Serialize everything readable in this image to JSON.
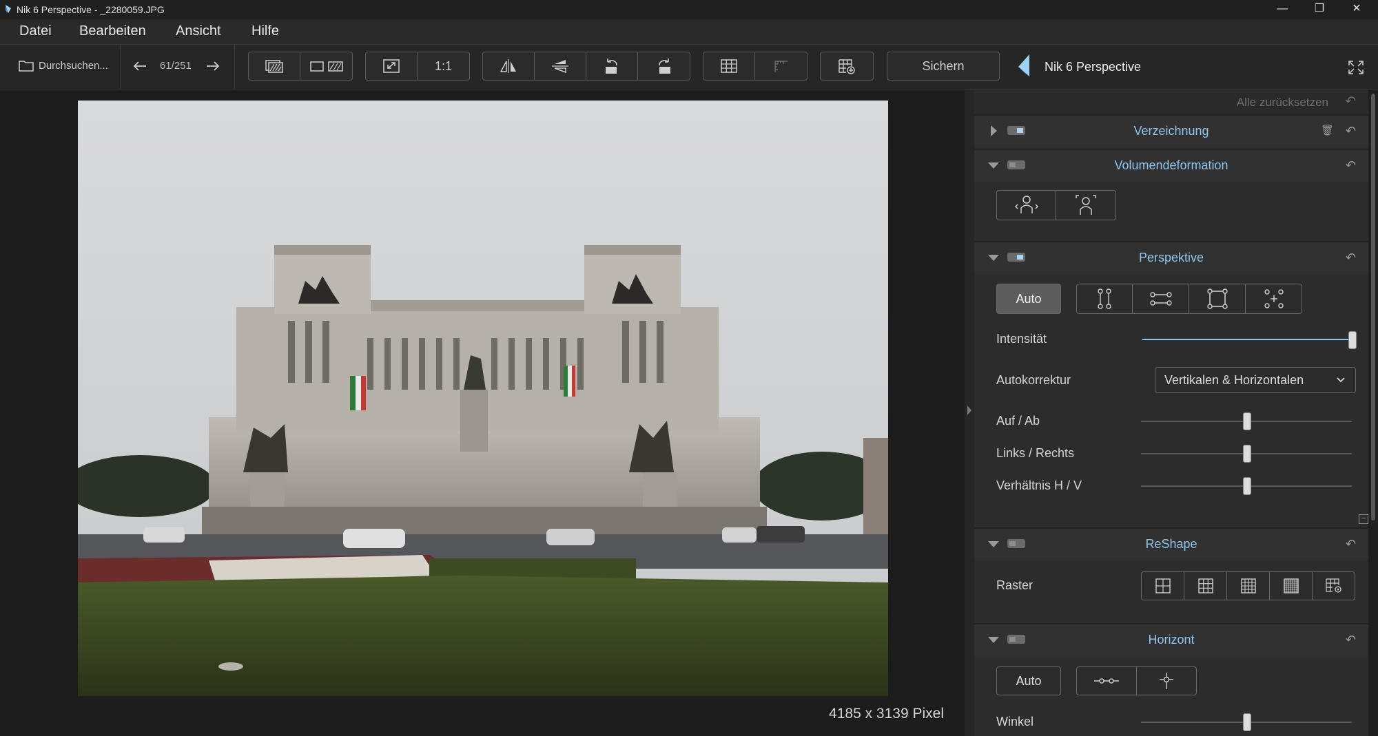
{
  "window": {
    "title": "Nik 6 Perspective - _2280059.JPG",
    "minimize": "—",
    "restore": "❐",
    "close": "✕"
  },
  "menu": [
    "Datei",
    "Bearbeiten",
    "Ansicht",
    "Hilfe"
  ],
  "toolbar": {
    "browse_label": "Durchsuchen...",
    "counter": "61/251",
    "zoom_1to1": "1:1",
    "save_label": "Sichern",
    "app_name": "Nik 6 Perspective"
  },
  "canvas": {
    "dimensions": "4185 x 3139 Pixel"
  },
  "panel": {
    "reset_all": "Alle zurücksetzen",
    "sections": {
      "verzeichnung": {
        "title": "Verzeichnung"
      },
      "volumendeformation": {
        "title": "Volumendeformation"
      },
      "perspektive": {
        "title": "Perspektive",
        "auto_label": "Auto",
        "intensitaet_label": "Intensität",
        "intensitaet_value": 1.0,
        "autokorrektur_label": "Autokorrektur",
        "autokorrektur_value": "Vertikalen & Horizontalen",
        "auf_ab_label": "Auf / Ab",
        "auf_ab_value": 0.5,
        "links_rechts_label": "Links / Rechts",
        "links_rechts_value": 0.5,
        "verhaeltnis_label": "Verhältnis H / V",
        "verhaeltnis_value": 0.5
      },
      "reshape": {
        "title": "ReShape",
        "raster_label": "Raster"
      },
      "horizont": {
        "title": "Horizont",
        "auto_label": "Auto",
        "winkel_label": "Winkel",
        "winkel_value": 0.5
      }
    }
  },
  "colors": {
    "accent": "#8fc4ec",
    "panel_bg": "#2c2c2c",
    "canvas_bg": "#1c1c1c"
  }
}
